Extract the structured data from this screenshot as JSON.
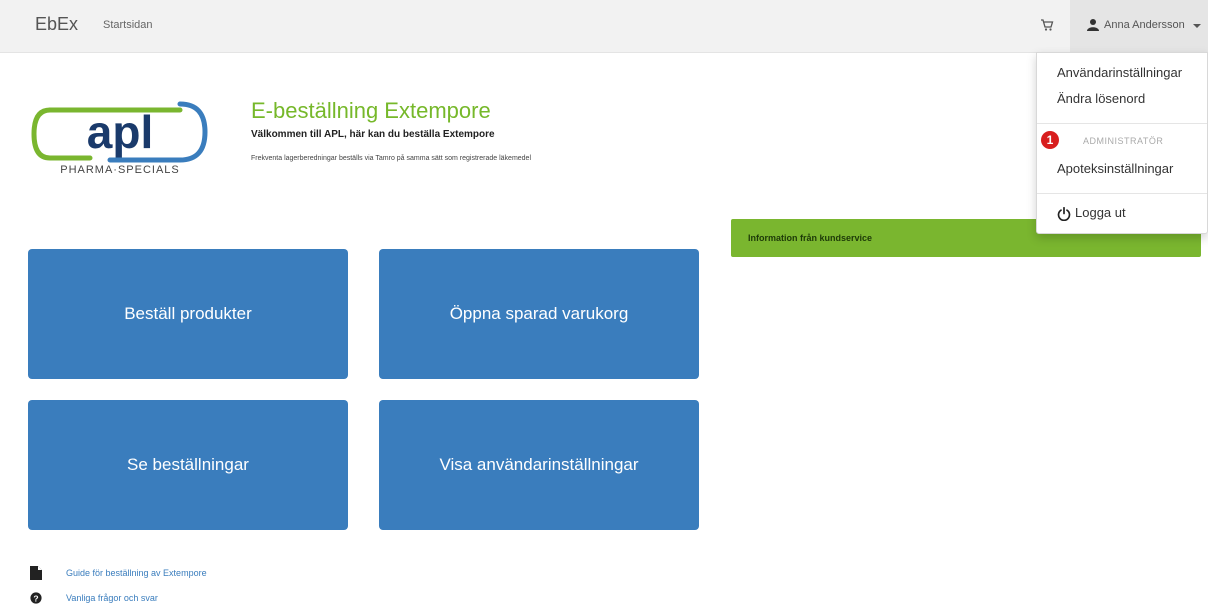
{
  "navbar": {
    "brand": "EbEx",
    "home_link": "Startsidan",
    "cart_icon": "shopping-cart-icon",
    "user": {
      "icon": "user-icon",
      "name": "Anna Andersson"
    }
  },
  "logo": {
    "text": "apl",
    "subtitle": "PHARMA·SPECIALS"
  },
  "hero": {
    "title": "E-beställning Extempore",
    "welcome": "Välkommen till APL, här kan du beställa Extempore",
    "note": "Frekventa lagerberedningar beställs via Tamro på samma sätt som registrerade läkemedel"
  },
  "tiles": [
    {
      "label": "Beställ produkter"
    },
    {
      "label": "Öppna sparad varukorg"
    },
    {
      "label": "Se beställningar"
    },
    {
      "label": "Visa användarinställningar"
    }
  ],
  "info_panel": {
    "title": "Information från kundservice"
  },
  "footer_links": [
    {
      "icon": "document-icon",
      "label": "Guide för beställning av Extempore"
    },
    {
      "icon": "question-circle-icon",
      "label": "Vanliga frågor och svar"
    }
  ],
  "user_dropdown": {
    "items": [
      "Användarinställningar",
      "Ändra lösenord"
    ],
    "admin_header": "ADMINISTRATÖR",
    "admin_items": [
      "Apoteksinställningar"
    ],
    "logout": "Logga ut",
    "badge": "1"
  },
  "colors": {
    "accent_blue": "#3a7dbd",
    "accent_green": "#76b82a",
    "info_green": "#7ab62f",
    "badge_red": "#d81e1e"
  }
}
